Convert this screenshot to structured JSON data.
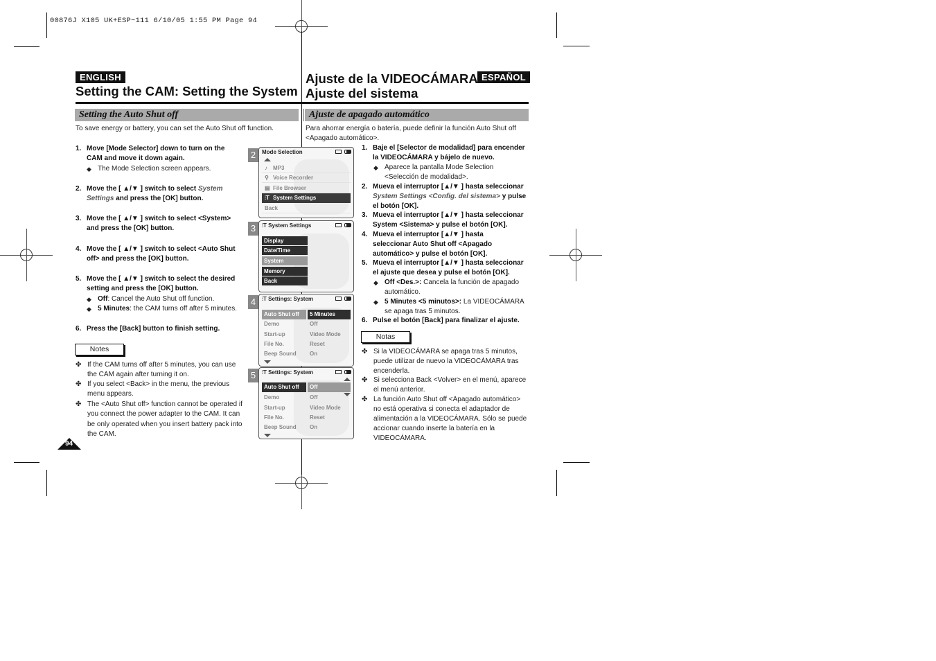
{
  "print_header": "00876J X105 UK+ESP~111  6/10/05 1:55 PM  Page 94",
  "english": {
    "lang_badge": "ENGLISH",
    "title": "Setting the CAM: Setting the System",
    "subhead": "Setting the Auto Shut off",
    "intro": "To save energy or battery, you can set the Auto Shut off function.",
    "steps": [
      {
        "num": "1.",
        "text": "Move [Mode Selector] down to turn on the CAM and move it down again.",
        "bullets": [
          "The Mode Selection screen appears."
        ]
      },
      {
        "num": "2.",
        "pre": "Move the [ ▲/▼ ] switch to select ",
        "em": "System Settings",
        "post": " and press the [OK] button."
      },
      {
        "num": "3.",
        "text": "Move the [ ▲/▼ ] switch to select <System> and press the [OK] button."
      },
      {
        "num": "4.",
        "text": "Move the [ ▲/▼ ] switch to select <Auto Shut off> and press the [OK] button."
      },
      {
        "num": "5.",
        "text": "Move the [ ▲/▼ ] switch to select the desired setting and press the [OK] button.",
        "bullets": [
          {
            "term": "Off",
            "desc": ": Cancel the Auto Shut off function."
          },
          {
            "term": "5 Minutes",
            "desc": ": the CAM turns off after 5 minutes."
          }
        ]
      },
      {
        "num": "6.",
        "text": "Press the [Back] button to finish setting."
      }
    ],
    "notes_label": "Notes",
    "notes": [
      "If the CAM turns off after 5 minutes, you can use the CAM again after turning it on.",
      "If you select <Back> in the menu, the previous menu appears.",
      "The <Auto Shut off> function cannot be operated if you connect the power adapter to the CAM. It can be only operated when you insert battery pack into the CAM."
    ],
    "page_number": "94"
  },
  "spanish": {
    "lang_badge": "ESPAÑOL",
    "title_line1": "Ajuste de la VIDEOCÁMARA:",
    "title_line2": "Ajuste del sistema",
    "subhead": "Ajuste de apagado automático",
    "intro": "Para ahorrar energía o batería, puede definir la función Auto Shut off <Apagado automático>.",
    "steps": [
      {
        "num": "1.",
        "text": "Baje el [Selector de modalidad] para encender la VIDEOCÁMARA y bájelo de nuevo.",
        "bullets": [
          "Aparece la pantalla Mode Selection <Selección de modalidad>."
        ]
      },
      {
        "num": "2.",
        "pre": "Mueva el interruptor [▲/▼ ] hasta seleccionar ",
        "em": "System Settings <Config. del sistema>",
        "post": " y pulse el botón [OK]."
      },
      {
        "num": "3.",
        "text": "Mueva el interruptor [▲/▼ ] hasta seleccionar System <Sistema> y pulse el botón [OK]."
      },
      {
        "num": "4.",
        "text": "Mueva el interruptor [▲/▼ ] hasta seleccionar Auto Shut off <Apagado automático> y pulse el botón [OK]."
      },
      {
        "num": "5.",
        "text": "Mueva el interruptor [▲/▼ ] hasta seleccionar el ajuste que desea y pulse el botón [OK].",
        "bullets": [
          {
            "term": "Off <Des.>:",
            "desc": " Cancela la función de apagado automático."
          },
          {
            "term": "5 Minutes <5 minutos>:",
            "desc": " La VIDEOCÁMARA se apaga tras 5 minutos."
          }
        ]
      },
      {
        "num": "6.",
        "text": "Pulse el botón [Back] para finalizar el ajuste."
      }
    ],
    "notes_label": "Notas",
    "notes": [
      "Si la VIDEOCÁMARA se apaga tras 5 minutos, puede utilizar de nuevo la VIDEOCÁMARA tras encenderla.",
      "Si selecciona Back <Volver> en el menú, aparece el menú anterior.",
      "La función Auto Shut off <Apagado automático> no está operativa si conecta el adaptador de alimentación a la VIDEOCÁMARA. Sólo se puede accionar cuando inserte la batería en la VIDEOCÁMARA."
    ]
  },
  "screens": [
    {
      "step": "2",
      "title": "Mode Selection",
      "items": [
        {
          "icon": "♪",
          "icon_name": "music-note-icon",
          "label": "MP3"
        },
        {
          "icon": "🎙",
          "icon_name": "microphone-icon",
          "label": "Voice Recorder"
        },
        {
          "icon": "▤",
          "icon_name": "folder-icon",
          "label": "File Browser"
        },
        {
          "icon": "⫶T",
          "icon_name": "settings-icon",
          "label": "System Settings",
          "selected": true
        },
        {
          "icon": "",
          "icon_name": "",
          "label": "Back"
        }
      ]
    },
    {
      "step": "3",
      "title": "System Settings",
      "items": [
        {
          "label": "Display"
        },
        {
          "label": "Date/Time"
        },
        {
          "label": "System",
          "selected": true
        },
        {
          "label": "Memory"
        },
        {
          "label": "Back"
        }
      ]
    },
    {
      "step": "4",
      "title": "Settings: System",
      "rows": [
        {
          "key": "Auto Shut off",
          "value": "5 Minutes",
          "selected": true
        },
        {
          "key": "Demo",
          "value": "Off"
        },
        {
          "key": "Start-up",
          "value": "Video Mode"
        },
        {
          "key": "File No.",
          "value": "Reset"
        },
        {
          "key": "Beep Sound",
          "value": "On"
        }
      ]
    },
    {
      "step": "5",
      "title": "Settings: System",
      "rows": [
        {
          "key": "Auto Shut off",
          "value": "Off",
          "selected": true
        },
        {
          "key": "Demo",
          "value": "Off"
        },
        {
          "key": "Start-up",
          "value": "Video Mode"
        },
        {
          "key": "File No.",
          "value": "Reset"
        },
        {
          "key": "Beep Sound",
          "value": "On"
        }
      ]
    }
  ]
}
